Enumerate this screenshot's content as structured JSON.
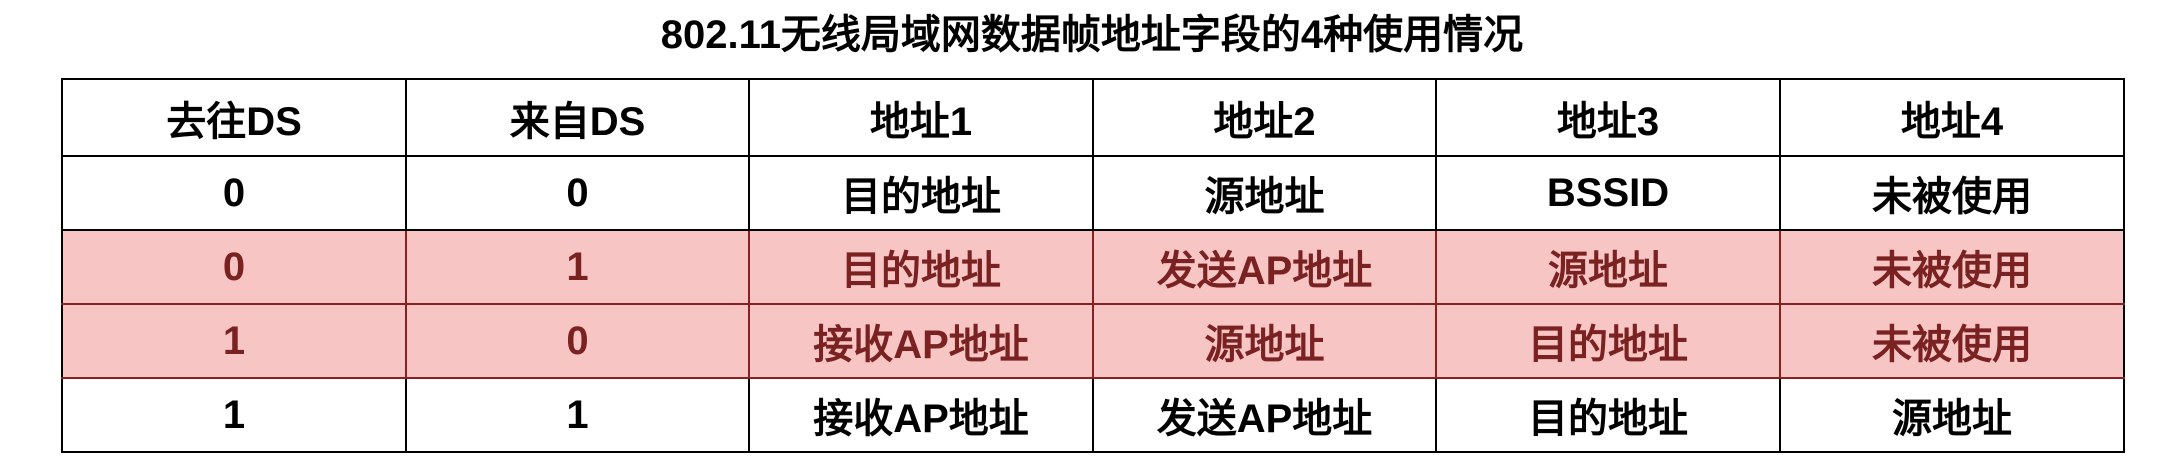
{
  "title": "802.11无线局域网数据帧地址字段的4种使用情况",
  "table": {
    "headers": [
      "去往DS",
      "来自DS",
      "地址1",
      "地址2",
      "地址3",
      "地址4"
    ],
    "rows": [
      [
        "0",
        "0",
        "目的地址",
        "源地址",
        "BSSID",
        "未被使用"
      ],
      [
        "0",
        "1",
        "目的地址",
        "发送AP地址",
        "源地址",
        "未被使用"
      ],
      [
        "1",
        "0",
        "接收AP地址",
        "源地址",
        "目的地址",
        "未被使用"
      ],
      [
        "1",
        "1",
        "接收AP地址",
        "发送AP地址",
        "目的地址",
        "源地址"
      ]
    ]
  },
  "colors": {
    "highlight_background": "#f7c6c4",
    "highlight_text": "#7a2222",
    "border": "#000000"
  }
}
